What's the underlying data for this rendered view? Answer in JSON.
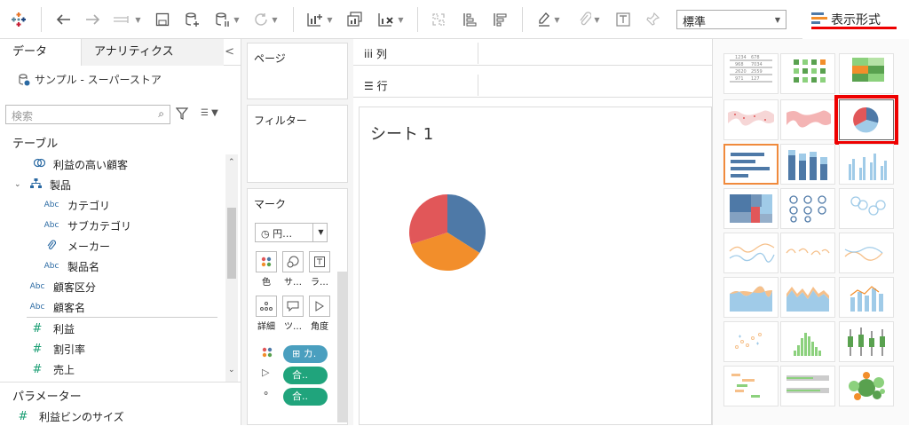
{
  "toolbar": {
    "icons": [
      "tableau-logo-icon",
      "undo-icon",
      "redo-icon",
      "replay-icon",
      "save-icon",
      "new-datasource-icon",
      "pause-icon",
      "refresh-icon",
      "new-worksheet-icon",
      "duplicate-icon",
      "clear-icon",
      "swap-icon",
      "sort-asc-icon",
      "sort-desc-icon",
      "highlight-icon",
      "group-icon",
      "label-icon",
      "pin-icon"
    ],
    "fit_value": "標準",
    "showme_label": "表示形式"
  },
  "datapane": {
    "tab_data": "データ",
    "tab_analytics": "アナリティクス",
    "datasource": "サンプル - スーパーストア",
    "search_placeholder": "検索",
    "tables_header": "テーブル",
    "fields": [
      {
        "label": "利益の高い顧客",
        "icon": "set-icon"
      },
      {
        "label": "製品",
        "icon": "hierarchy-icon"
      },
      {
        "label": "カテゴリ",
        "icon": "Abc"
      },
      {
        "label": "サブカテゴリ",
        "icon": "Abc"
      },
      {
        "label": "メーカー",
        "icon": "paperclip-icon"
      },
      {
        "label": "製品名",
        "icon": "Abc"
      },
      {
        "label": "顧客区分",
        "icon": "Abc"
      },
      {
        "label": "顧客名",
        "icon": "Abc"
      },
      {
        "label": "利益",
        "icon": "#"
      },
      {
        "label": "割引率",
        "icon": "#"
      },
      {
        "label": "売上",
        "icon": "#"
      }
    ],
    "params_header": "パラメーター",
    "params": [
      {
        "label": "利益ビンのサイズ",
        "icon": "#"
      }
    ]
  },
  "shelves": {
    "pages": "ページ",
    "filters": "フィルター",
    "marks": "マーク",
    "mark_type": "円…",
    "mark_buttons": [
      "色",
      "サ…",
      "ラ…",
      "詳細",
      "ツ…",
      "角度"
    ],
    "pills": [
      "カ.",
      "合..",
      "合.."
    ],
    "columns": "列",
    "rows": "行"
  },
  "sheet": {
    "title": "シート 1",
    "pie": {
      "slices": [
        {
          "value": 34,
          "color": "#4e79a7"
        },
        {
          "value": 36,
          "color": "#f28e2b"
        },
        {
          "value": 30,
          "color": "#e15759"
        }
      ]
    }
  },
  "showme": {
    "selected": "horizontal-bars",
    "highlighted": "pie-chart"
  }
}
